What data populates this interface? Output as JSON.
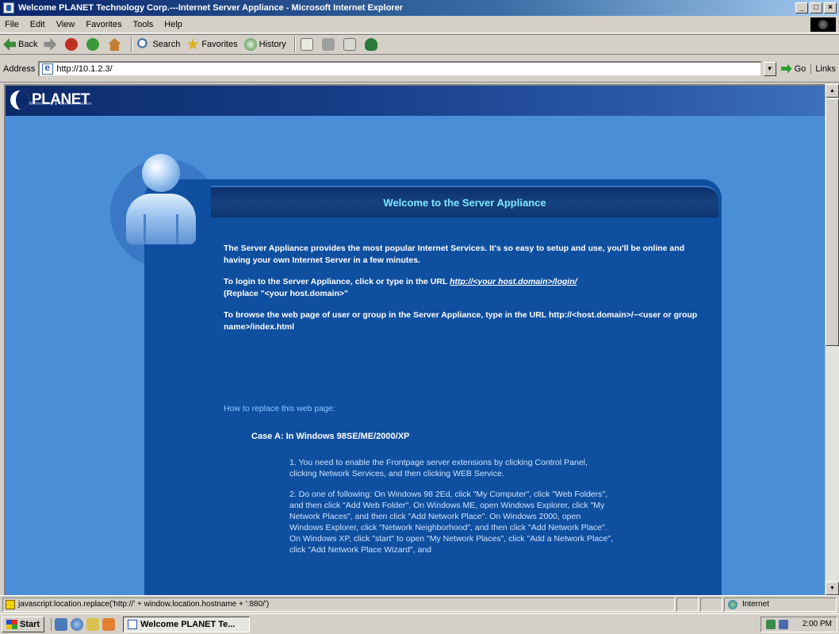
{
  "window": {
    "title": "Welcome PLANET Technology Corp.---Internet Server Appliance - Microsoft Internet Explorer",
    "buttons": {
      "minimize": "_",
      "maximize": "□",
      "close": "×"
    }
  },
  "menubar": {
    "items": [
      {
        "label": "File"
      },
      {
        "label": "Edit"
      },
      {
        "label": "View"
      },
      {
        "label": "Favorites"
      },
      {
        "label": "Tools"
      },
      {
        "label": "Help"
      }
    ]
  },
  "toolbar": {
    "back_label": "Back",
    "search_label": "Search",
    "favorites_label": "Favorites",
    "history_label": "History"
  },
  "addressbar": {
    "label": "Address",
    "url": "http://10.1.2.3/",
    "go_label": "Go",
    "links_label": "Links"
  },
  "page": {
    "brand": {
      "name": "PLANET",
      "tagline": "Networking & Communication"
    },
    "panel_title": "Welcome to the Server Appliance",
    "para1": "The Server Appliance provides the most popular Internet Services. It's so easy to setup and use, you'll be online and having your own Internet Server in a few minutes.",
    "para2_text": "To login to the Server Appliance, click or type in the URL",
    "para2_link": "http://<your host.domain>/login/",
    "para2_note": "(Replace \"<your host.domain>\"",
    "para3": "To browse the web page of user or group in the Server Appliance, type in the URL http://<host.domain>/~<user or group name>/index.html",
    "howto": "How to replace this web page:",
    "case_a": "Case A: In Windows 98SE/ME/2000/XP",
    "step1": "1. You need to enable the Frontpage server extensions by clicking Control Panel, clicking Network Services, and then clicking WEB Service.",
    "step2": "2. Do one of following: On Windows 98 2Ed, click \"My Computer\", click \"Web Folders\", and then click \"Add Web Folder\". On Windows ME, open Windows Explorer, click \"My Network Places\", and then click \"Add Network Place\". On Windows 2000, open Windows Explorer, click \"Network Neighborhood\", and then click \"Add Network Place\". On Windows XP, click \"start\" to open \"My Network Places\", click \"Add a Network Place\", click \"Add Network Place Wizard\", and"
  },
  "statusbar": {
    "message": "javascript:location.replace('http://' + window.location.hostname + ':880/')",
    "zone": "Internet"
  },
  "taskbar": {
    "start_label": "Start",
    "task_label": "Welcome PLANET Te...",
    "clock": "2:00 PM"
  },
  "colors": {
    "page_background": "#4a8ed8",
    "panel": "#0f4fa0",
    "panel_title": "#7fe6ff"
  }
}
